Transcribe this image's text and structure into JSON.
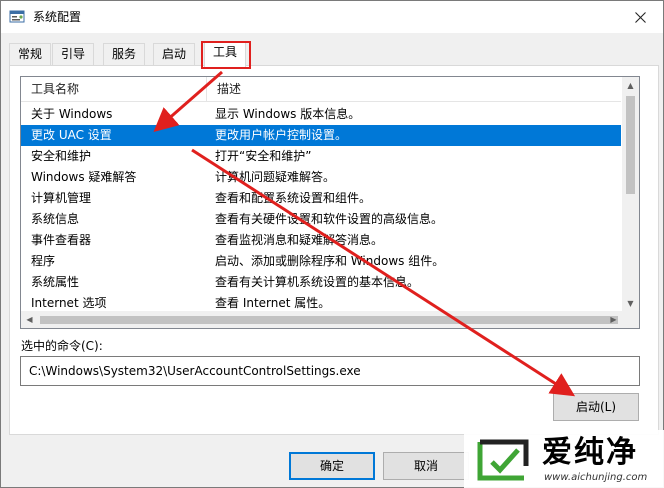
{
  "window": {
    "title": "系统配置",
    "close_icon": "close-icon"
  },
  "tabs": [
    {
      "label": "常规",
      "active": false
    },
    {
      "label": "引导",
      "active": false
    },
    {
      "label": "服务",
      "active": false
    },
    {
      "label": "启动",
      "active": false
    },
    {
      "label": "工具",
      "active": true
    }
  ],
  "tools_list": {
    "columns": [
      "工具名称",
      "描述"
    ],
    "rows": [
      {
        "name": "关于 Windows",
        "description": "显示 Windows 版本信息。"
      },
      {
        "name": "更改 UAC 设置",
        "description": "更改用户帐户控制设置。",
        "selected": true
      },
      {
        "name": "安全和维护",
        "description": "打开“安全和维护”"
      },
      {
        "name": "Windows 疑难解答",
        "description": "计算机问题疑难解答。"
      },
      {
        "name": "计算机管理",
        "description": "查看和配置系统设置和组件。"
      },
      {
        "name": "系统信息",
        "description": "查看有关硬件设置和软件设置的高级信息。"
      },
      {
        "name": "事件查看器",
        "description": "查看监视消息和疑难解答消息。"
      },
      {
        "name": "程序",
        "description": "启动、添加或删除程序和 Windows 组件。"
      },
      {
        "name": "系统属性",
        "description": "查看有关计算机系统设置的基本信息。"
      },
      {
        "name": "Internet 选项",
        "description": "查看 Internet 属性。"
      }
    ]
  },
  "command": {
    "label": "选中的命令(C):",
    "value": "C:\\Windows\\System32\\UserAccountControlSettings.exe"
  },
  "buttons": {
    "launch": "启动(L)",
    "ok": "确定",
    "cancel": "取消"
  },
  "watermark": {
    "title": "爱纯净",
    "url": "www.aichunjing.com"
  },
  "colors": {
    "selection": "#0078d7",
    "annotation_red": "#e0201e",
    "logo_green": "#3fa535"
  }
}
